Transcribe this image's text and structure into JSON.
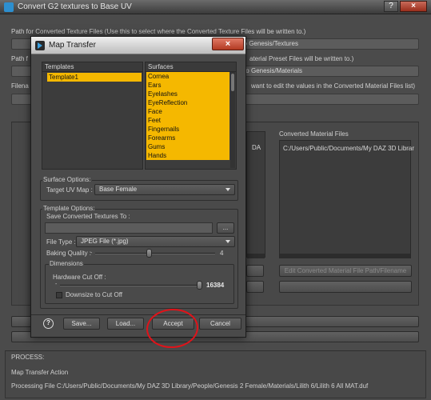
{
  "outer": {
    "title": "Convert G2 textures to Base UV",
    "help_label": "?",
    "close_label": "×",
    "texture_path_label": "Path for Converted Texture Files (Use this to select where the Converted Texture Files will be written to.)",
    "texture_path_value": "2 to Genesis/Textures",
    "material_path_label_left": "Path f",
    "material_path_label_right": "aterial Preset Files will be written to.)",
    "material_path_value": "2 to Genesis/Materials",
    "filename_label_left": "Filena",
    "filename_label_right": "want to edit the values in the Converted Material Files list)",
    "left_list_fragment": "DA",
    "converted_files_header": "Converted Material Files",
    "converted_files_item": "C:/Users/Public/Documents/My DAZ 3D Librar",
    "edit_button_label": "Edit Converted Material File Path/Filename",
    "process_label": "PROCESS:",
    "process_action": "Map Transfer Action",
    "process_file": "Processing File C:/Users/Public/Documents/My DAZ 3D Library/People/Genesis 2 Female/Materials/Lilith 6/Lilith 6 All MAT.duf"
  },
  "dialog": {
    "title": "Map Transfer",
    "close_label": "×",
    "templates_header": "Templates",
    "templates": [
      "Template1"
    ],
    "surfaces_header": "Surfaces",
    "surfaces": [
      "Cornea",
      "Ears",
      "Eyelashes",
      "EyeReflection",
      "Face",
      "Feet",
      "Fingernails",
      "Forearms",
      "Gums",
      "Hands"
    ],
    "surface_options_label": "Surface Options:",
    "target_uv_label": "Target UV Map :",
    "target_uv_value": "Base Female",
    "template_options_label": "Template Options:",
    "save_textures_label": "Save Converted Textures To :",
    "browse_label": "...",
    "file_type_label": "File Type :",
    "file_type_value": "JPEG File (*.jpg)",
    "baking_quality_label": "Baking Quality :",
    "baking_quality_value": "4",
    "baking_quality_level": 0.45,
    "dimensions_label": "Dimensions",
    "hardware_cutoff_label": "Hardware Cut Off :",
    "hardware_cutoff_value": "16384",
    "hardware_cutoff_level": 1.0,
    "downsize_label": "Downsize to Cut Off",
    "help_icon": "question-circle-icon",
    "buttons": {
      "save": "Save...",
      "load": "Load...",
      "accept": "Accept",
      "cancel": "Cancel"
    }
  },
  "colors": {
    "selection_yellow": "#f5b800",
    "annotation_red": "#e0131a"
  }
}
